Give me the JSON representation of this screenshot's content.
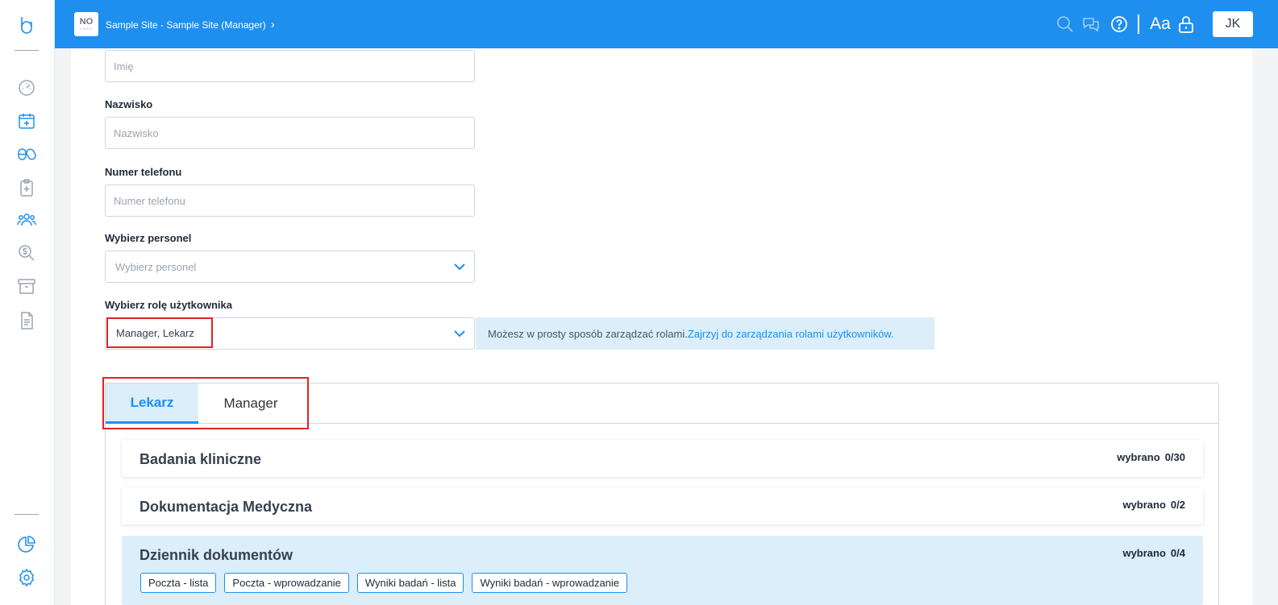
{
  "header": {
    "logo_text": "NO",
    "logo_sub": "LOGO",
    "breadcrumb": "Sample Site - Sample Site (Manager)",
    "chevron": "›",
    "user_initials": "JK",
    "icons": [
      "search-icon",
      "chat-icon",
      "help-icon",
      "font-size-icon",
      "lock-icon"
    ],
    "font_label": "Aa"
  },
  "sidebar": {
    "icons": [
      "logo-icon",
      "dashboard-icon",
      "calendar-add-icon",
      "pills-icon",
      "clipboard-add-icon",
      "users-icon",
      "billing-search-icon",
      "archive-icon",
      "document-icon",
      "pie-chart-icon",
      "settings-icon"
    ]
  },
  "form": {
    "first_name": {
      "placeholder": "Imię"
    },
    "last_name": {
      "label": "Nazwisko",
      "placeholder": "Nazwisko"
    },
    "phone": {
      "label": "Numer telefonu",
      "placeholder": "Numer telefonu"
    },
    "staff": {
      "label": "Wybierz personel",
      "placeholder": "Wybierz personel"
    },
    "role": {
      "label": "Wybierz rolę użytkownika",
      "value": "Manager, Lekarz"
    },
    "info": {
      "text": "Możesz w prosty sposób zarządzać rolami.",
      "link": "Zajrzyj do zarządzania rolami użytkowników."
    }
  },
  "tabs": [
    {
      "label": "Lekarz",
      "active": true
    },
    {
      "label": "Manager",
      "active": false
    }
  ],
  "modules": [
    {
      "title": "Badania kliniczne",
      "count_label": "wybrano",
      "count": "0/30"
    },
    {
      "title": "Dokumentacja Medyczna",
      "count_label": "wybrano",
      "count": "0/2"
    },
    {
      "title": "Dziennik dokumentów",
      "count_label": "wybrano",
      "count": "0/4",
      "items": [
        "Poczta - lista",
        "Poczta - wprowadzanie",
        "Wyniki badań - lista",
        "Wyniki badań - wprowadzanie"
      ]
    }
  ],
  "colors": {
    "accent": "#1e8fee",
    "highlight": "#dc2626",
    "light_blue": "#dbeefa"
  }
}
